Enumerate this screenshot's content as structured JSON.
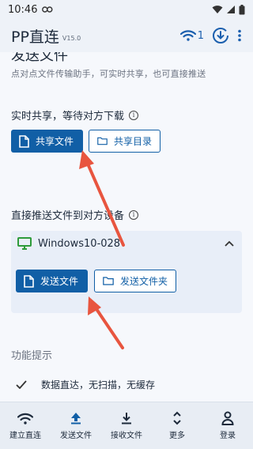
{
  "status_bar": {
    "time": "10:46"
  },
  "app_bar": {
    "title": "PP直连",
    "version": "V15.0",
    "connected_count": "1"
  },
  "page": {
    "title": "发送文件",
    "subtitle": "点对点文件传输助手，可实时共享，也可直接推送"
  },
  "share_section": {
    "label": "实时共享，等待对方下载",
    "share_file_label": "共享文件",
    "share_dir_label": "共享目录"
  },
  "push_section": {
    "label": "直接推送文件到对方设备",
    "device_name": "Windows10-028",
    "send_file_label": "发送文件",
    "send_folder_label": "发送文件夹"
  },
  "hints": {
    "label": "功能提示",
    "items": [
      "数据直达，无扫描，无缓存"
    ]
  },
  "bottom_nav": {
    "items": [
      {
        "label": "建立直连",
        "icon": "wifi-icon"
      },
      {
        "label": "发送文件",
        "icon": "upload-icon"
      },
      {
        "label": "接收文件",
        "icon": "download-icon"
      },
      {
        "label": "更多",
        "icon": "more-icon"
      },
      {
        "label": "登录",
        "icon": "user-icon"
      }
    ]
  },
  "colors": {
    "primary": "#115fa6",
    "arrow": "#e8553f",
    "background": "#f6f8fc"
  }
}
